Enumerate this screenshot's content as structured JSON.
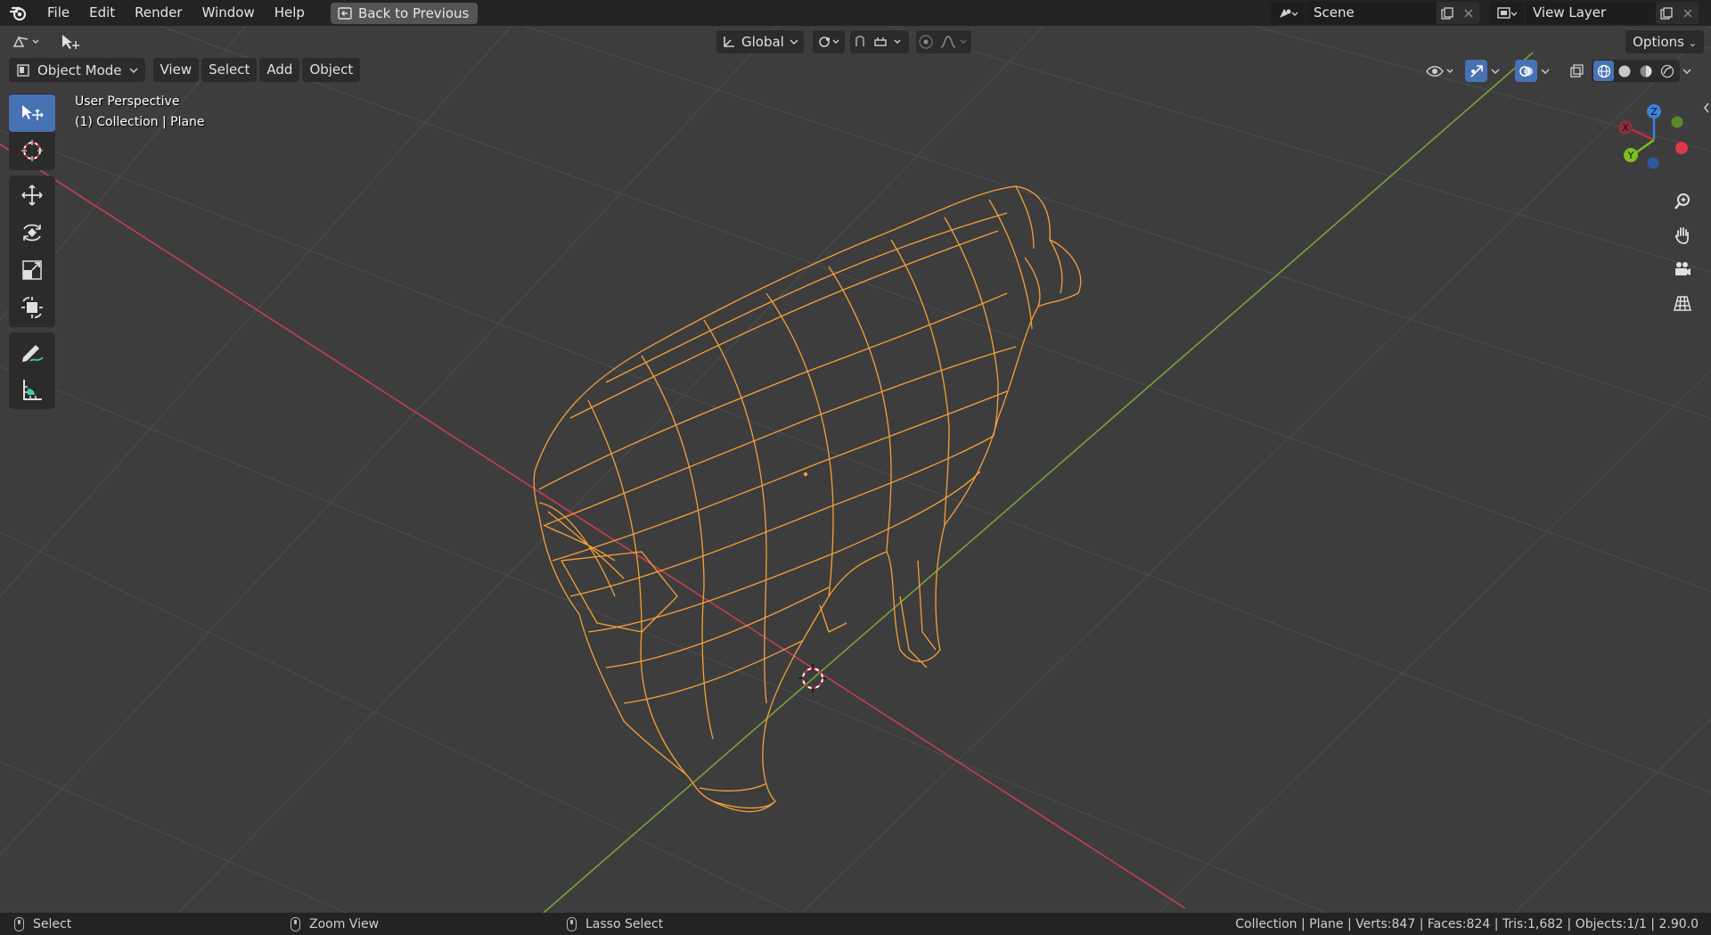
{
  "menubar": {
    "items": [
      "File",
      "Edit",
      "Render",
      "Window",
      "Help"
    ],
    "back_button": "Back to Previous",
    "scene_name": "Scene",
    "view_layer_name": "View Layer"
  },
  "tool_header": {
    "orientation": "Global",
    "options_label": "Options"
  },
  "mode_header": {
    "mode": "Object Mode",
    "menus": [
      "View",
      "Select",
      "Add",
      "Object"
    ]
  },
  "viewport": {
    "perspective_label": "User Perspective",
    "collection_label": "(1) Collection | Plane",
    "gizmo_axes": [
      "X",
      "Y",
      "Z"
    ],
    "colors": {
      "background": "#3d3d3d",
      "grid": "#4a4a4a",
      "x_axis": "#c04050",
      "y_axis": "#7aa23a",
      "selection_wire": "#f5a03a",
      "active_tool": "#4772b3"
    }
  },
  "toolbar": {
    "tools": [
      "select-box-icon",
      "cursor-icon",
      "move-icon",
      "rotate-icon",
      "scale-icon",
      "transform-icon",
      "annotate-icon",
      "measure-icon"
    ]
  },
  "statusbar": {
    "left_action": "Select",
    "middle_action": "Zoom View",
    "right_action": "Lasso Select",
    "stats": "Collection | Plane | Verts:847 | Faces:824 | Tris:1,682 | Objects:1/1 | 2.90.0"
  }
}
